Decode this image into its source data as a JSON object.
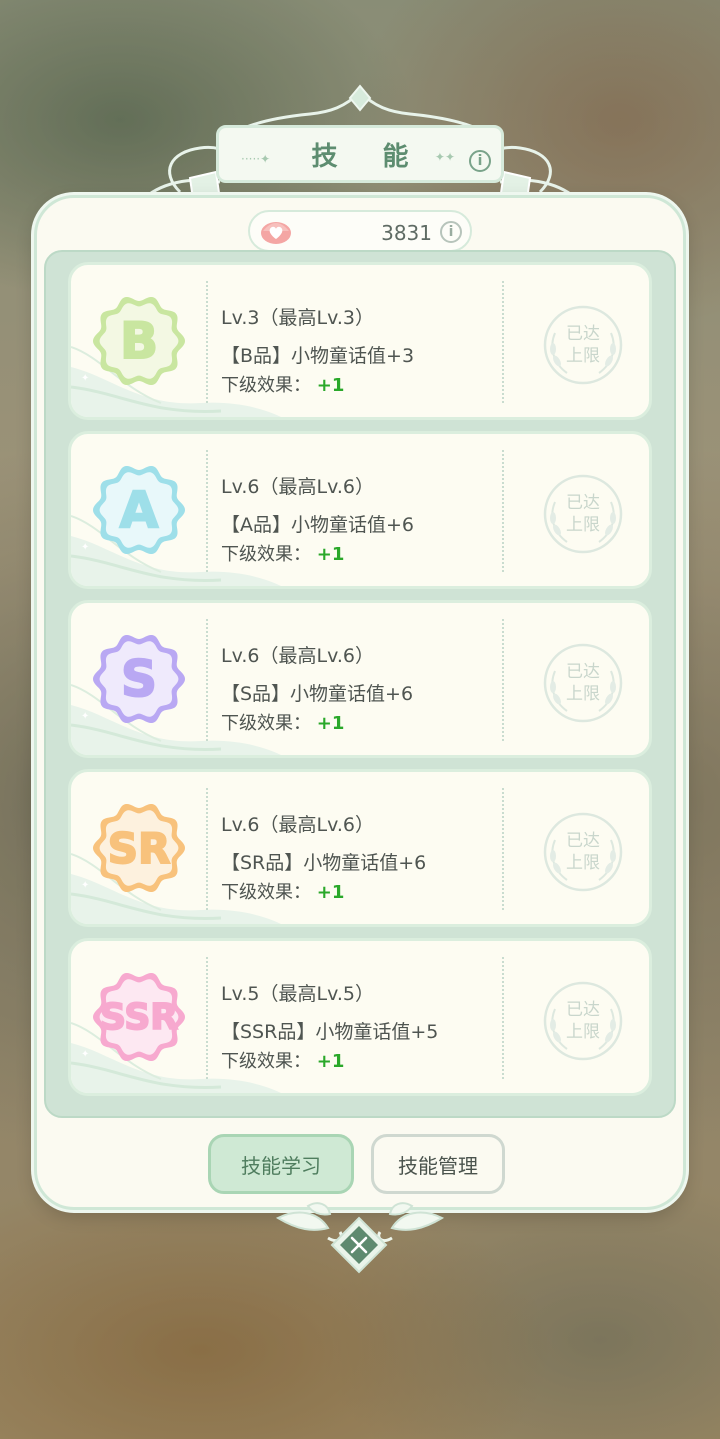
{
  "title": "技 能",
  "currency": {
    "value": "3831",
    "icon": "heart-shell-icon"
  },
  "skills": [
    {
      "grade": "B",
      "lv": "Lv.3（最高Lv.3）",
      "effect": "【B品】小物童话值+3",
      "next_label": "下级效果：",
      "next_value": "+1",
      "status": "已达上限",
      "status_l1": "已达",
      "status_l2": "上限",
      "color": "#c9e6a0",
      "fill": "#f3f8e3"
    },
    {
      "grade": "A",
      "lv": "Lv.6（最高Lv.6）",
      "effect": "【A品】小物童话值+6",
      "next_label": "下级效果：",
      "next_value": "+1",
      "status": "已达上限",
      "status_l1": "已达",
      "status_l2": "上限",
      "color": "#9edfe9",
      "fill": "#e8f8fa"
    },
    {
      "grade": "S",
      "lv": "Lv.6（最高Lv.6）",
      "effect": "【S品】小物童话值+6",
      "next_label": "下级效果：",
      "next_value": "+1",
      "status": "已达上限",
      "status_l1": "已达",
      "status_l2": "上限",
      "color": "#b9a8f3",
      "fill": "#efeafc"
    },
    {
      "grade": "SR",
      "lv": "Lv.6（最高Lv.6）",
      "effect": "【SR品】小物童话值+6",
      "next_label": "下级效果：",
      "next_value": "+1",
      "status": "已达上限",
      "status_l1": "已达",
      "status_l2": "上限",
      "color": "#f8c27c",
      "fill": "#fdf1de"
    },
    {
      "grade": "SSR",
      "lv": "Lv.5（最高Lv.5）",
      "effect": "【SSR品】小物童话值+5",
      "next_label": "下级效果：",
      "next_value": "+1",
      "status": "已达上限",
      "status_l1": "已达",
      "status_l2": "上限",
      "color": "#f7a9cf",
      "fill": "#fde8f2"
    }
  ],
  "buttons": {
    "learn": "技能学习",
    "manage": "技能管理"
  },
  "colors": {
    "accent": "#5d8d70",
    "panel_border": "#cfe7d6",
    "plus_green": "#2aa82a"
  }
}
